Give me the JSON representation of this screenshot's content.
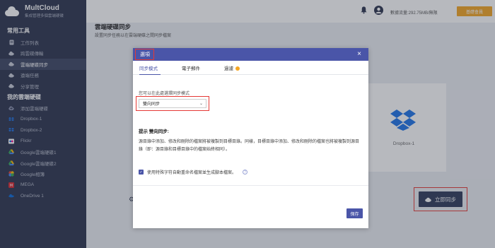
{
  "app": {
    "name": "MultCloud",
    "tagline": "集成管理多個雲端硬碟"
  },
  "sidebar": {
    "section1": "常用工具",
    "tools": [
      {
        "label": "工作列表",
        "icon": "doc-icon"
      },
      {
        "label": "跨雲碟傳輸",
        "icon": "cloud-transfer-icon"
      },
      {
        "label": "雲端硬碟同步",
        "icon": "cloud-sync-icon",
        "active": true
      },
      {
        "label": "遠端任務",
        "icon": "cloud-upload-icon"
      },
      {
        "label": "分享管理",
        "icon": "cloud-share-icon"
      }
    ],
    "section2": "我的雲端硬碟",
    "drives": [
      {
        "label": "添加雲端硬碟",
        "icon": "add-drive-icon",
        "color": "#8a93b0"
      },
      {
        "label": "Dropbox-1",
        "icon": "dropbox-icon",
        "color": "#1e73e8"
      },
      {
        "label": "Dropbox-2",
        "icon": "dropbox-icon",
        "color": "#1e73e8"
      },
      {
        "label": "Flickr",
        "icon": "flickr-icon",
        "color": "#ff0084"
      },
      {
        "label": "Google雲端硬碟1",
        "icon": "google-drive-icon",
        "color": "#34a853"
      },
      {
        "label": "Google雲端硬碟2",
        "icon": "google-drive-icon",
        "color": "#34a853"
      },
      {
        "label": "Google相簿",
        "icon": "google-photos-icon",
        "color": "#fbbc05"
      },
      {
        "label": "MEGA",
        "icon": "mega-icon",
        "color": "#d9272e"
      },
      {
        "label": "OneDrive 1",
        "icon": "onedrive-icon",
        "color": "#0a6ad8"
      }
    ]
  },
  "topbar": {
    "traffic": "數據流量:292.75MB/無限",
    "upgrade": "基礎會員"
  },
  "main": {
    "title": "雲端硬碟同步",
    "description": "設置同步任務以在雲端硬碟之間同步檔案",
    "target_card": "Dropbox-1",
    "sync_now": "立即同步"
  },
  "modal": {
    "title": "選項",
    "close": "×",
    "tabs": [
      {
        "label": "同步模式",
        "active": true
      },
      {
        "label": "電子郵件"
      },
      {
        "label": "過濾",
        "premium": true
      }
    ],
    "mode_label": "您可以在此處選擇同步模式",
    "mode_selected": "雙向同步",
    "tip_title": "提示 雙向同步:",
    "tip_body": "源目錄中添加、修改和刪除的檔案將被複製到目標目錄。同樣，目標目錄中添加、修改和刪除的檔案也將被複製到源目錄（即：源目錄和目標目錄中的檔案始終相同）。",
    "checkbox_label": "使用特殊字符自動重命名檔案並生成腳本檔案。",
    "checkbox_checked": true,
    "save": "保存"
  },
  "colors": {
    "accent": "#4a55a8",
    "sidebar": "#2b334d",
    "highlight": "#e53935",
    "upgrade": "#f5a623"
  }
}
